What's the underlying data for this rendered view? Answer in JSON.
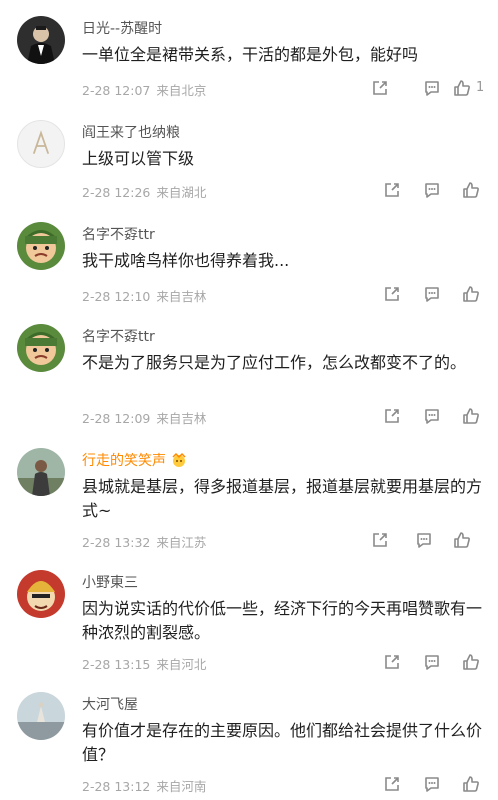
{
  "comments": [
    {
      "username": "日光--苏醒时",
      "text": "一单位全是裙带关系，干活的都是外包，能好吗",
      "time": "2-28 12:07",
      "location": "来自北京",
      "likes": "1",
      "avatar": "man-in-suit-avatar"
    },
    {
      "username": "阎王来了也纳粮",
      "text": "上级可以管下级",
      "time": "2-28 12:26",
      "location": "来自湖北",
      "likes": "",
      "avatar": "letter-a-avatar"
    },
    {
      "username": "名字不孬ttr",
      "text": "我干成啥鸟样你也得养着我...",
      "time": "2-28 12:10",
      "location": "来自吉林",
      "likes": "",
      "avatar": "soldier-cartoon-avatar"
    },
    {
      "username": "名字不孬ttr",
      "text": "不是为了服务只是为了应付工作，怎么改都变不了的。",
      "time": "2-28 12:09",
      "location": "来自吉林",
      "likes": "",
      "avatar": "soldier-cartoon-avatar"
    },
    {
      "username": "行走的笑笑声",
      "text": "县城就是基层，得多报道基层，报道基层就要用基层的方式~",
      "time": "2-28 13:32",
      "location": "来自江苏",
      "likes": "",
      "avatar": "person-photo-avatar"
    },
    {
      "username": "小野東三",
      "text": "因为说实话的代价低一些，经济下行的今天再唱赞歌有一种浓烈的割裂感。",
      "time": "2-28 13:15",
      "location": "来自河北",
      "likes": "",
      "avatar": "cartoon-face-avatar"
    },
    {
      "username": "大河飞屋",
      "text": "有价值才是存在的主要原因。他们都给社会提供了什么价值？",
      "time": "2-28 13:12",
      "location": "来自河南",
      "likes": "",
      "avatar": "landscape-avatar"
    }
  ],
  "colors": {
    "username_vip": "#ff8a00",
    "meta": "#a7a7a7",
    "icon": "#8a8a8a"
  }
}
